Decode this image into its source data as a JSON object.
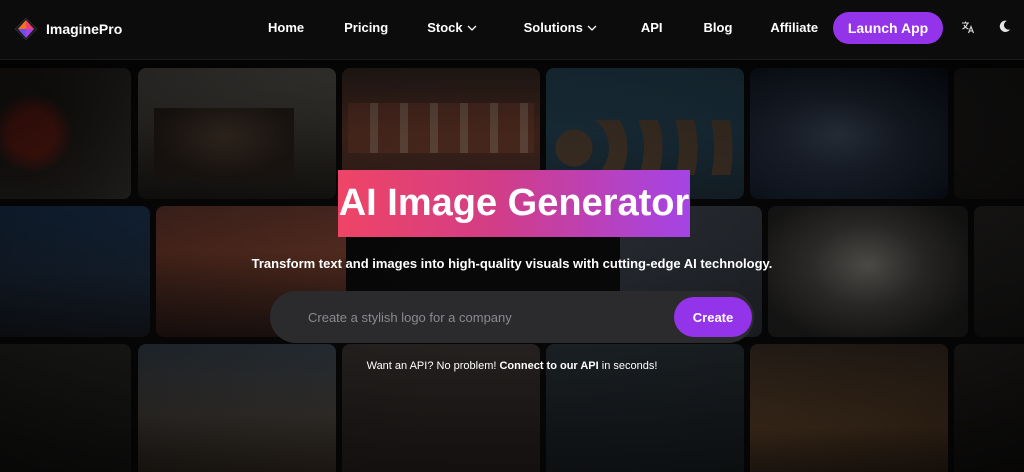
{
  "brand": {
    "name": "ImaginePro",
    "logo_icon": "imaginepro-logo-icon",
    "accent": "#9333ea"
  },
  "nav": {
    "items": [
      {
        "label": "Home"
      },
      {
        "label": "Pricing"
      },
      {
        "label": "Stock",
        "has_dropdown": true
      },
      {
        "label": "Solutions",
        "has_dropdown": true
      },
      {
        "label": "API"
      },
      {
        "label": "Blog"
      },
      {
        "label": "Affiliate"
      }
    ],
    "launch_label": "Launch App",
    "icons": [
      "translate-icon",
      "moon-icon"
    ]
  },
  "hero": {
    "title": "AI Image Generator",
    "subtitle": "Transform text and images into high-quality visuals with cutting-edge AI technology.",
    "title_gradient": [
      "#ef4466",
      "#a444e6"
    ]
  },
  "search": {
    "placeholder": "Create a stylish logo for a company",
    "value": "",
    "button_label": "Create"
  },
  "api_promo": {
    "prefix": "Want an API? No problem! ",
    "link": "Connect to our API",
    "suffix": " in seconds!"
  }
}
